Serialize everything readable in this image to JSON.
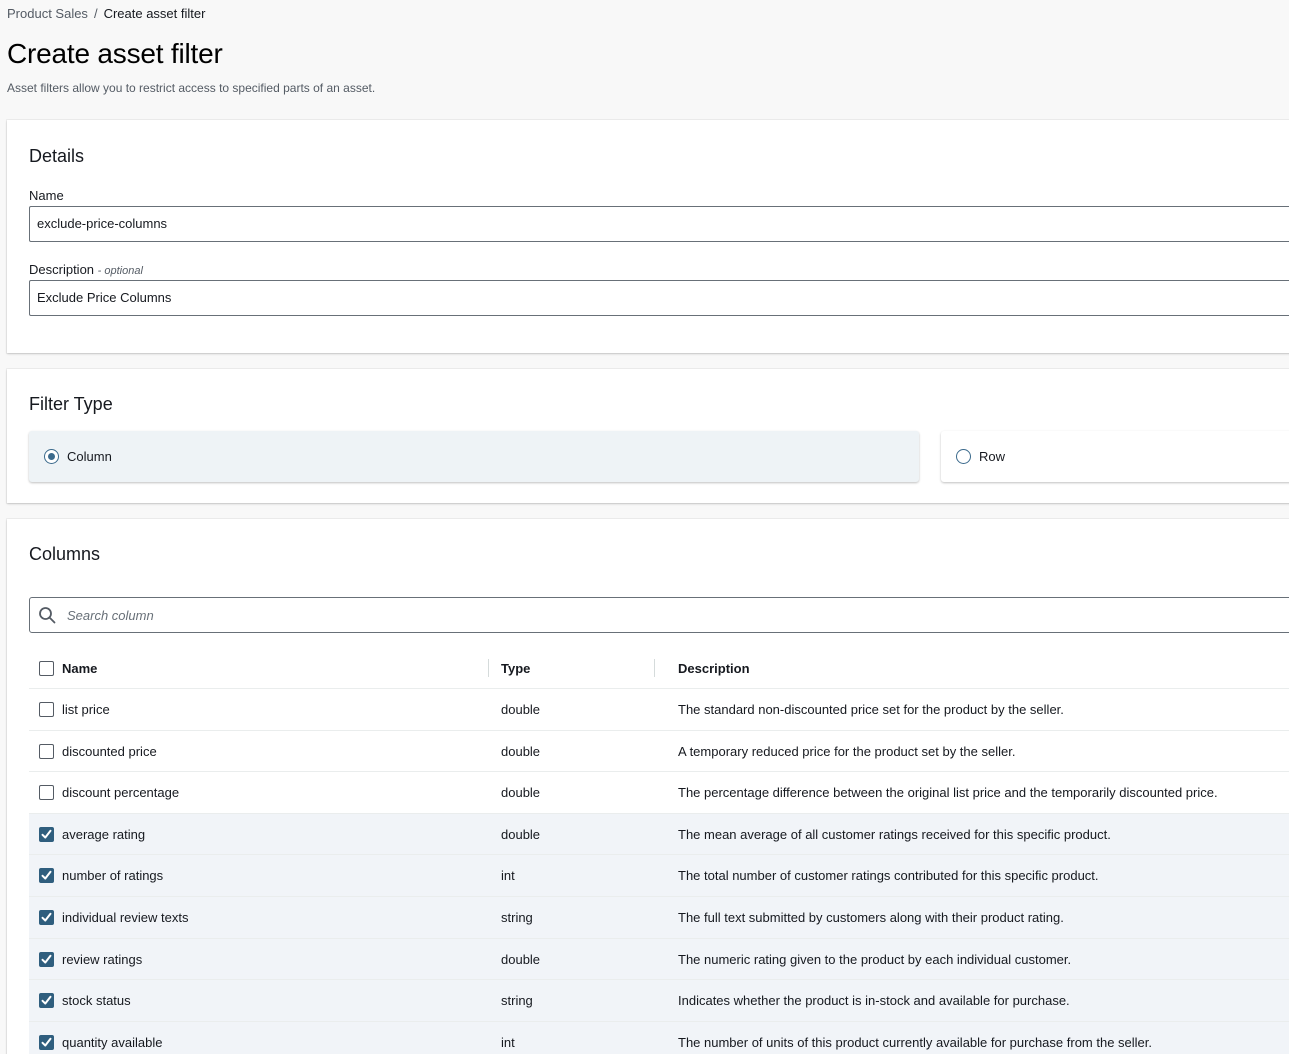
{
  "breadcrumb": {
    "parent": "Product Sales",
    "separator": "/",
    "current": "Create asset filter"
  },
  "page": {
    "title": "Create asset filter",
    "description": "Asset filters allow you to restrict access to specified parts of an asset."
  },
  "details": {
    "title": "Details",
    "name_label": "Name",
    "name_value": "exclude-price-columns",
    "description_label": "Description",
    "description_optional": "- optional",
    "description_value": "Exclude Price Columns"
  },
  "filter_type": {
    "title": "Filter Type",
    "options": [
      {
        "label": "Column",
        "selected": true
      },
      {
        "label": "Row",
        "selected": false
      }
    ]
  },
  "columns": {
    "title": "Columns",
    "search_placeholder": "Search column",
    "headers": {
      "name": "Name",
      "type": "Type",
      "description": "Description"
    },
    "rows": [
      {
        "name": "list price",
        "type": "double",
        "description": "The standard non-discounted price set for the product by the seller.",
        "checked": false
      },
      {
        "name": "discounted price",
        "type": "double",
        "description": "A temporary reduced price for the product set by the seller.",
        "checked": false
      },
      {
        "name": "discount percentage",
        "type": "double",
        "description": "The percentage difference between the original list price and the temporarily discounted price.",
        "checked": false
      },
      {
        "name": "average rating",
        "type": "double",
        "description": "The mean average of all customer ratings received for this specific product.",
        "checked": true
      },
      {
        "name": "number of ratings",
        "type": "int",
        "description": "The total number of customer ratings contributed for this specific product.",
        "checked": true
      },
      {
        "name": "individual review texts",
        "type": "string",
        "description": "The full text submitted by customers along with their product rating.",
        "checked": true
      },
      {
        "name": "review ratings",
        "type": "double",
        "description": "The numeric rating given to the product by each individual customer.",
        "checked": true
      },
      {
        "name": "stock status",
        "type": "string",
        "description": "Indicates whether the product is in-stock and available for purchase.",
        "checked": true
      },
      {
        "name": "quantity available",
        "type": "int",
        "description": "The number of units of this product currently available for purchase from the seller.",
        "checked": true
      }
    ]
  },
  "colors": {
    "accent": "#2f5e7e",
    "selected_row": "#f1f4f8",
    "tile_selected": "#eef3f6"
  }
}
